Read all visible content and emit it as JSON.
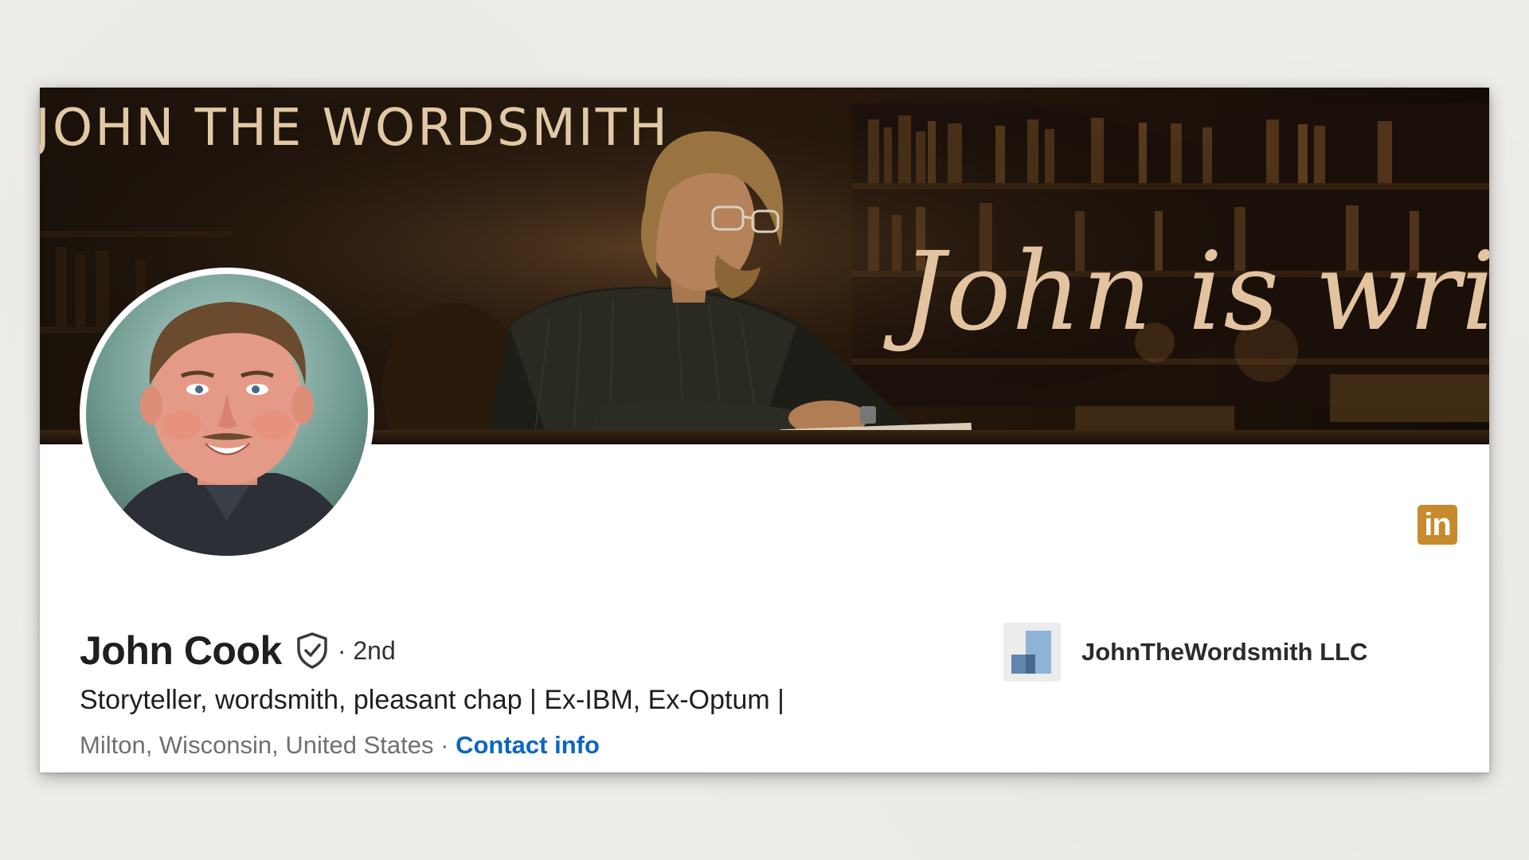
{
  "banner": {
    "title": "JOHN THE WORDSMITH",
    "script_text": "John is writing"
  },
  "profile": {
    "name": "John Cook",
    "degree": "· 2nd",
    "headline": "Storyteller, wordsmith, pleasant chap | Ex-IBM, Ex-Optum |",
    "location": "Milton, Wisconsin, United States",
    "separator": " · ",
    "contact_label": "Contact info"
  },
  "company": {
    "name": "JohnTheWordsmith LLC"
  },
  "badge": {
    "linkedin_label": "in"
  },
  "colors": {
    "accent_link": "#0a66c2",
    "linkedin_badge": "#c88a2e",
    "banner_text": "#e2c9a6"
  }
}
